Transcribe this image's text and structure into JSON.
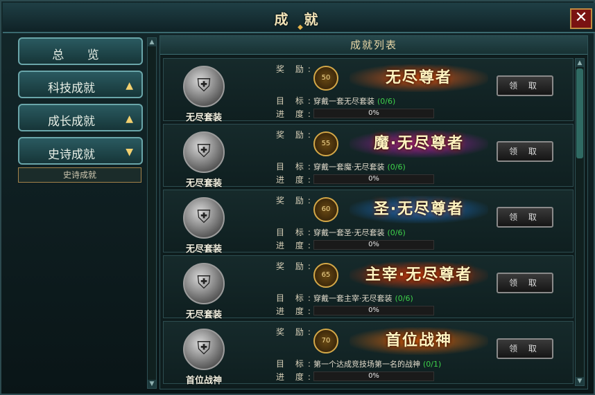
{
  "window": {
    "title": "成 就",
    "close_glyph": "✕"
  },
  "nav": {
    "items": [
      {
        "label": "总 览",
        "arrow": ""
      },
      {
        "label": "科技成就",
        "arrow": "▲"
      },
      {
        "label": "成长成就",
        "arrow": "▲"
      },
      {
        "label": "史诗成就",
        "arrow": "▼"
      }
    ],
    "subitem": "史诗成就"
  },
  "list": {
    "header": "成就列表",
    "reward_label": "奖 励:",
    "target_label": "目 标:",
    "progress_label": "进 度:",
    "claim_label": "领 取",
    "rows": [
      {
        "medal_name": "无尽套装",
        "level": "50",
        "reward_title": "无尽尊者",
        "target": "穿戴一套无尽套装",
        "count": "(0/6)",
        "progress": "0%",
        "progress_value": 0,
        "title_color": "#c4521a"
      },
      {
        "medal_name": "无尽套装",
        "level": "55",
        "reward_title": "魔·无尽尊者",
        "target": "穿戴一套魔·无尽套装",
        "count": "(0/6)",
        "progress": "0%",
        "progress_value": 0,
        "title_color": "#a020a0"
      },
      {
        "medal_name": "无尽套装",
        "level": "60",
        "reward_title": "圣·无尽尊者",
        "target": "穿戴一套圣·无尽套装",
        "count": "(0/6)",
        "progress": "0%",
        "progress_value": 0,
        "title_color": "#1a70c8"
      },
      {
        "medal_name": "无尽套装",
        "level": "65",
        "reward_title": "主宰·无尽尊者",
        "target": "穿戴一套主宰·无尽套装",
        "count": "(0/6)",
        "progress": "0%",
        "progress_value": 0,
        "title_color": "#c83a10"
      },
      {
        "medal_name": "首位战神",
        "level": "70",
        "reward_title": "首位战神",
        "target": "第一个达成竞技场第一名的战神",
        "count": "(0/1)",
        "progress": "0%",
        "progress_value": 0,
        "title_color": "#c86010"
      }
    ]
  }
}
